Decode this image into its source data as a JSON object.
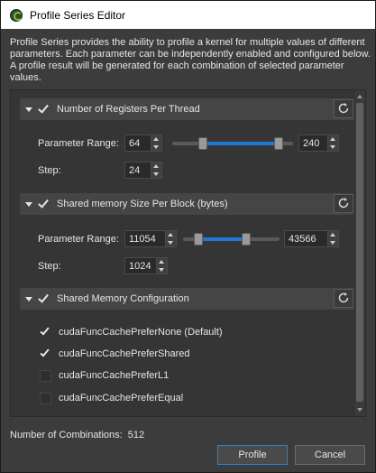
{
  "window": {
    "title": "Profile Series Editor"
  },
  "description": "Profile Series provides the ability to profile a kernel for multiple values of different parameters. Each parameter can be independently enabled and configured below. A profile result will be generated for each combination of selected parameter values.",
  "sections": [
    {
      "title": "Number of Registers Per Thread",
      "enabled": true,
      "range_label": "Parameter Range:",
      "range_min": "64",
      "range_max": "240",
      "step_label": "Step:",
      "step": "24"
    },
    {
      "title": "Shared memory Size Per Block (bytes)",
      "enabled": true,
      "range_label": "Parameter Range:",
      "range_min": "11054",
      "range_max": "43566",
      "step_label": "Step:",
      "step": "1024"
    },
    {
      "title": "Shared Memory Configuration",
      "enabled": true,
      "options": [
        {
          "label": "cudaFuncCachePreferNone (Default)",
          "checked": true
        },
        {
          "label": "cudaFuncCachePreferShared",
          "checked": true
        },
        {
          "label": "cudaFuncCachePreferL1",
          "checked": false
        },
        {
          "label": "cudaFuncCachePreferEqual",
          "checked": false
        }
      ]
    }
  ],
  "combinations": {
    "label": "Number of Combinations:",
    "value": "512"
  },
  "buttons": {
    "profile": "Profile",
    "cancel": "Cancel"
  },
  "colors": {
    "accent": "#1e7ad6",
    "background": "#3c3c3c",
    "titlebar": "#ffffff"
  }
}
